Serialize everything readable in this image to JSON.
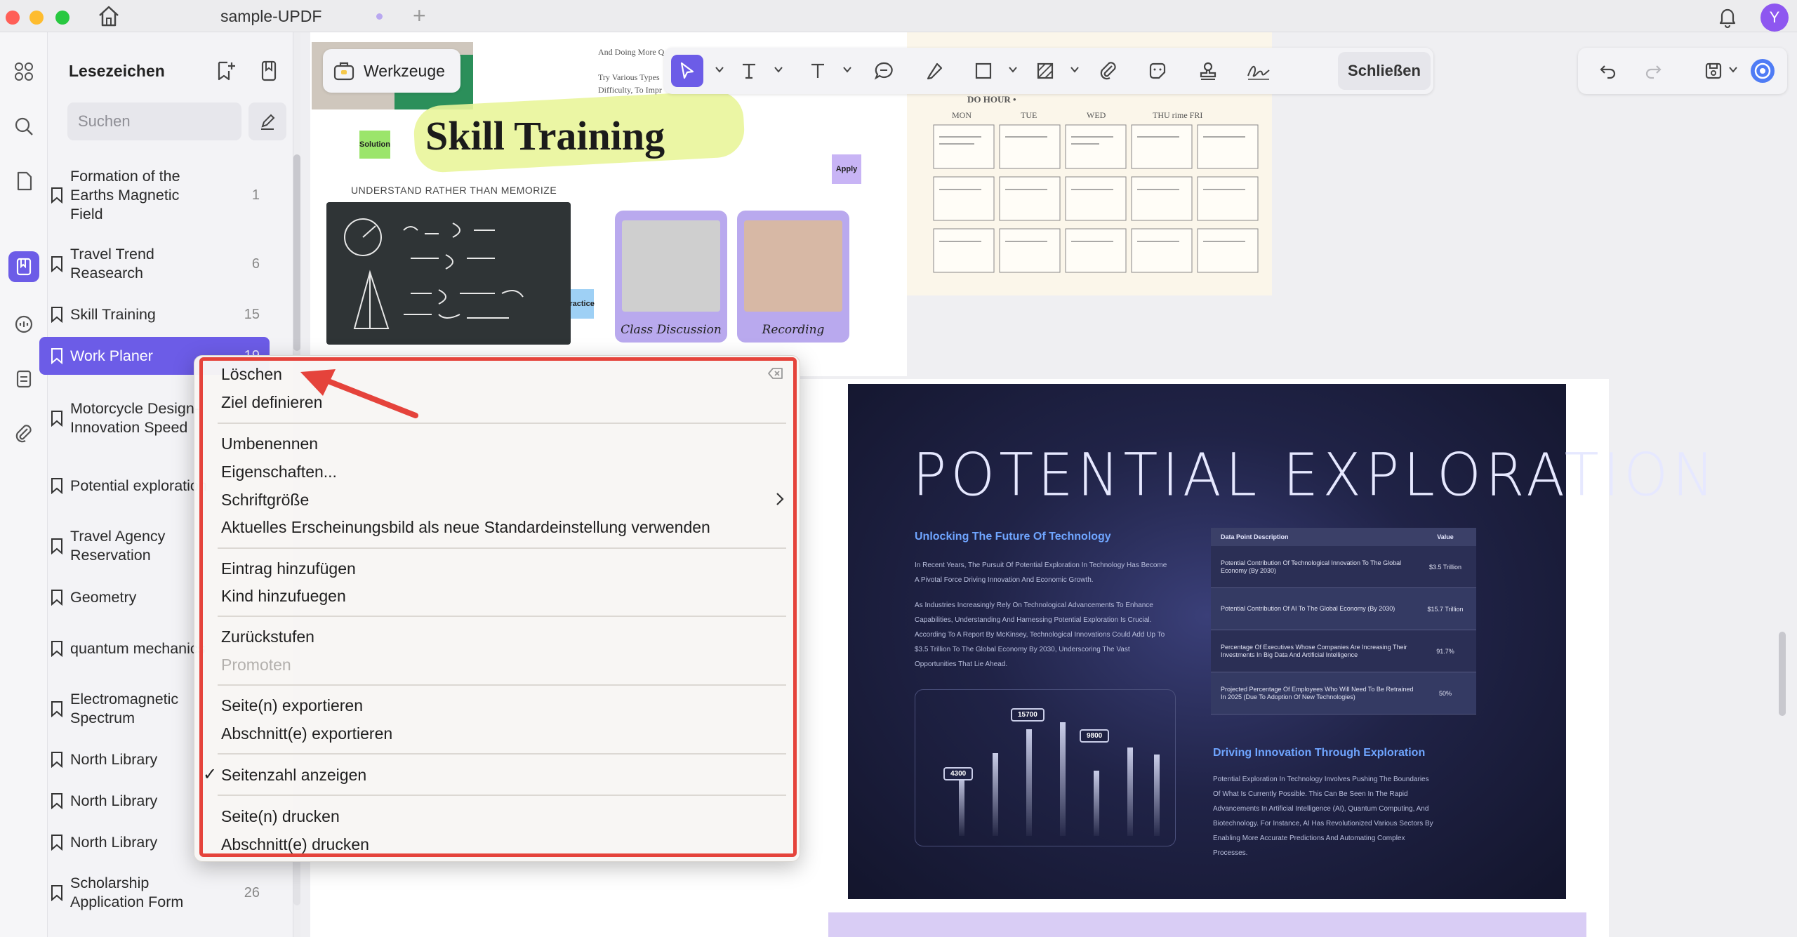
{
  "titlebar": {
    "tab_title": "sample-UPDF",
    "avatar_initial": "Y"
  },
  "panel": {
    "title": "Lesezeichen",
    "search_placeholder": "Suchen"
  },
  "bookmarks": [
    {
      "label": "Formation of the Earths Magnetic Field",
      "page": "1"
    },
    {
      "label": "Travel Trend Reasearch",
      "page": "6"
    },
    {
      "label": "Skill Training",
      "page": "15"
    },
    {
      "label": "Work Planer",
      "page": "19"
    },
    {
      "label": "Motorcycle Design-Innovation Speed",
      "page": ""
    },
    {
      "label": "Potential exploration",
      "page": ""
    },
    {
      "label": "Travel Agency Reservation",
      "page": ""
    },
    {
      "label": "Geometry",
      "page": ""
    },
    {
      "label": "quantum mechanics",
      "page": ""
    },
    {
      "label": "Electromagnetic Spectrum",
      "page": ""
    },
    {
      "label": "North Library",
      "page": ""
    },
    {
      "label": "North Library",
      "page": ""
    },
    {
      "label": "North Library",
      "page": ""
    },
    {
      "label": "Scholarship Application Form",
      "page": "26"
    }
  ],
  "toolbar": {
    "tools_label": "Werkzeuge",
    "close_label": "Schließen"
  },
  "context_menu": {
    "items": [
      {
        "label": "Löschen",
        "enabled": true
      },
      {
        "label": "Ziel definieren",
        "enabled": true
      },
      {
        "label": "Umbenennen",
        "enabled": true
      },
      {
        "label": "Eigenschaften...",
        "enabled": true
      },
      {
        "label": "Schriftgröße",
        "enabled": true,
        "submenu": true
      },
      {
        "label": "Aktuelles Erscheinungsbild als neue Standardeinstellung verwenden",
        "enabled": true
      },
      {
        "label": "Eintrag hinzufügen",
        "enabled": true
      },
      {
        "label": "Kind hinzufuegen",
        "enabled": true
      },
      {
        "label": "Zurückstufen",
        "enabled": true
      },
      {
        "label": "Promoten",
        "enabled": false
      },
      {
        "label": "Seite(n) exportieren",
        "enabled": true
      },
      {
        "label": "Abschnitt(e) exportieren",
        "enabled": true
      },
      {
        "label": "Seitenzahl anzeigen",
        "enabled": true,
        "checked": true
      },
      {
        "label": "Seite(n) drucken",
        "enabled": true
      },
      {
        "label": "Abschnitt(e) drucken",
        "enabled": true
      }
    ],
    "check_mark": "✓"
  },
  "page_skill": {
    "title": "Skill Training",
    "subtitle": "UNDERSTAND RATHER THAN MEMORIZE",
    "sticky_solution": "Solution",
    "sticky_apply": "Apply",
    "sticky_practice": "Practice",
    "photo1_caption": "Class Discussion",
    "photo2_caption": "Recording",
    "top_text_1": "And Doing More Q",
    "top_text_2": "Try Various Types",
    "top_text_3": "Difficulty, To Impr",
    "calendar_header": "DO HOUR •",
    "calendar_days": [
      "MON",
      "TUE",
      "WED",
      "THU rime FRI"
    ]
  },
  "page_exploration": {
    "title": "POTENTIAL EXPLORATION",
    "heading1": "Unlocking The Future Of Technology",
    "para1": "In Recent Years, The Pursuit Of Potential Exploration In Technology Has Become A Pivotal Force Driving Innovation And Economic Growth.",
    "para2": "As Industries Increasingly Rely On Technological Advancements To Enhance Capabilities, Understanding And Harnessing Potential Exploration Is Crucial. According To A Report By McKinsey, Technological Innovations Could Add Up To $3.5 Trillion To The Global Economy By 2030, Underscoring The Vast Opportunities That Lie Ahead.",
    "table_head": [
      "Data Point Description",
      "Value"
    ],
    "table_rows": [
      [
        "Potential Contribution Of Technological Innovation To The Global Economy (By 2030)",
        "$3.5 Trillion"
      ],
      [
        "Potential Contribution Of AI To The Global Economy (By 2030)",
        "$15.7 Trillion"
      ],
      [
        "Percentage Of Executives Whose Companies Are Increasing Their Investments In Big Data And Artificial Intelligence",
        "91.7%"
      ],
      [
        "Projected Percentage Of Employees Who Will Need To Be Retrained In 2025 (Due To Adoption Of New Technologies)",
        "50%"
      ]
    ],
    "heading2": "Driving Innovation Through Exploration",
    "para3": "Potential Exploration In Technology Involves Pushing The Boundaries Of What Is Currently Possible. This Can Be Seen In The Rapid Advancements In Artificial Intelligence (AI), Quantum Computing, And Biotechnology. For Instance, AI Has Revolutionized Various Sectors By Enabling More Accurate Predictions And Automating Complex Processes.",
    "chart_labels": [
      "4300",
      "15700",
      "9800"
    ]
  },
  "colors": {
    "accent": "#6c5ce7",
    "highlight_red": "#e5433b"
  }
}
